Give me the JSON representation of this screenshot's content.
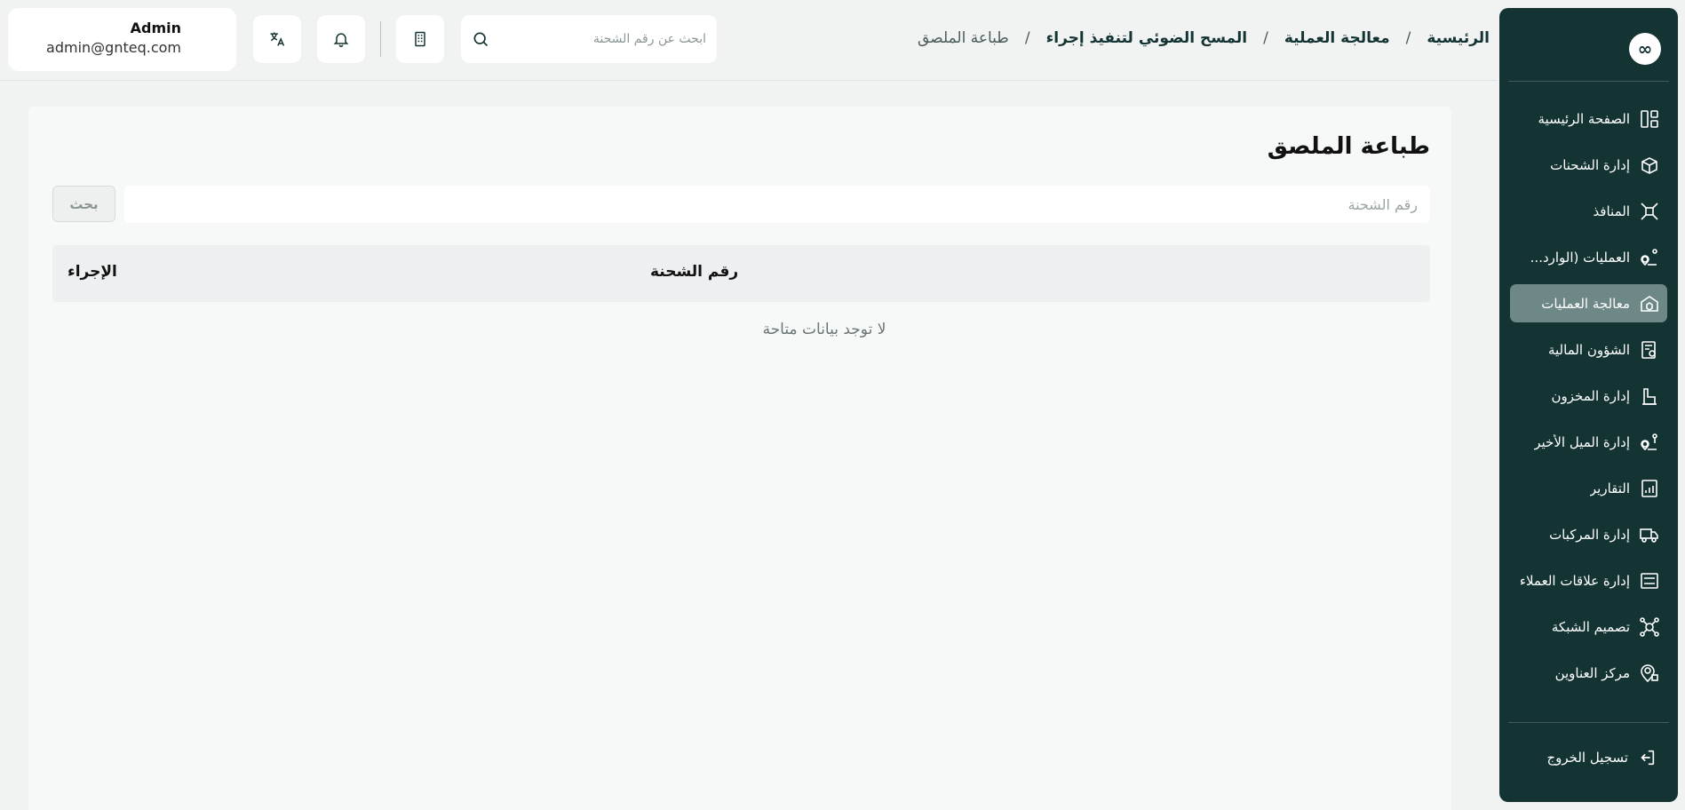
{
  "sidebar": {
    "logo_symbol": "∞",
    "items": [
      {
        "label": "الصفحة الرئيسية",
        "icon": "dashboard-icon",
        "active": false
      },
      {
        "label": "إدارة الشحنات",
        "icon": "package-icon",
        "active": false
      },
      {
        "label": "المنافذ",
        "icon": "ports-icon",
        "active": false
      },
      {
        "label": "العمليات (الوارد...",
        "icon": "route-pin-icon",
        "active": false
      },
      {
        "label": "معالجة العمليات",
        "icon": "warehouse-box-icon",
        "active": true
      },
      {
        "label": "الشؤون المالية",
        "icon": "finance-icon",
        "active": false
      },
      {
        "label": "إدارة المخزون",
        "icon": "inventory-icon",
        "active": false
      },
      {
        "label": "إدارة الميل الأخير",
        "icon": "last-mile-icon",
        "active": false
      },
      {
        "label": "التقارير",
        "icon": "reports-icon",
        "active": false
      },
      {
        "label": "إدارة المركبات",
        "icon": "truck-icon",
        "active": false
      },
      {
        "label": "إدارة علاقات العملاء",
        "icon": "crm-icon",
        "active": false
      },
      {
        "label": "تصميم الشبكة",
        "icon": "network-icon",
        "active": false
      },
      {
        "label": "مركز العناوين",
        "icon": "address-pin-icon",
        "active": false
      }
    ],
    "logout_label": "تسجيل الخروج"
  },
  "header": {
    "breadcrumb": [
      "الرئيسية",
      "معالجة العملية",
      "المسح الضوئي لتنفيذ إجراء",
      "طباعة الملصق"
    ],
    "breadcrumb_separator": "/",
    "search_placeholder": "ابحث عن رقم الشحنة",
    "user": {
      "name": "Admin",
      "email": "admin@gnteq.com"
    }
  },
  "main": {
    "title": "طباعة الملصق",
    "filter_placeholder": "رقم الشحنة",
    "search_button": "بحث",
    "columns": {
      "shipment": "رقم الشحنة",
      "action": "الإجراء"
    },
    "empty_message": "لا توجد بيانات متاحة"
  },
  "colors": {
    "sidebar_bg": "#143434",
    "active_item": "#6e8787",
    "page_bg": "#f1f3f3"
  }
}
